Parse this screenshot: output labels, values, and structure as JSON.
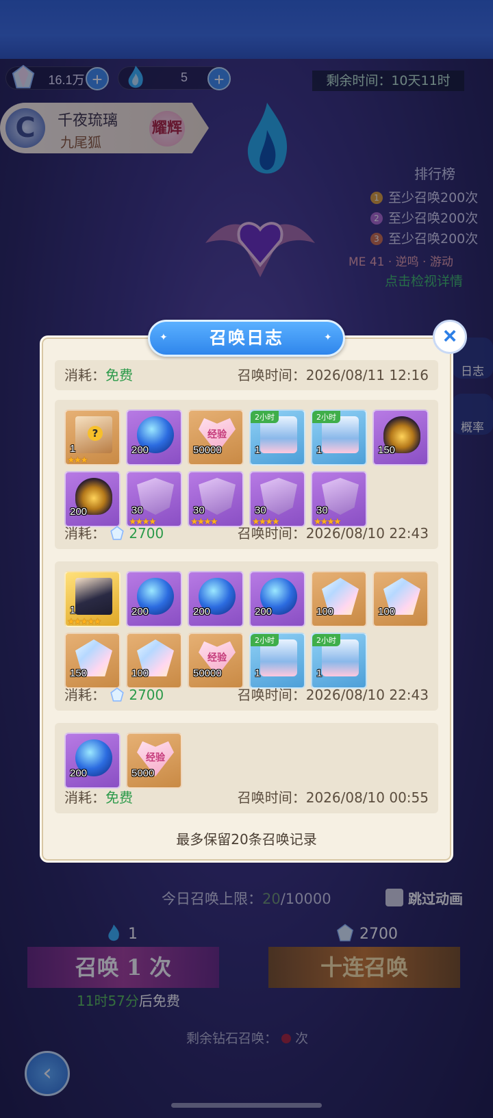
{
  "topbar": {
    "resource1": {
      "value": "16.1万",
      "icon": "crystal-gem-icon"
    },
    "resource2": {
      "value": "5",
      "icon": "blue-flame-icon"
    },
    "remaining_time": "剩余时间：10天11时"
  },
  "hero": {
    "name": "千夜琉璃",
    "subtitle": "九尾狐",
    "badge": "耀辉"
  },
  "ranking": {
    "title": "排行榜",
    "rows": [
      {
        "num": "1",
        "text": "至少召唤200次",
        "color": "#e0a23a"
      },
      {
        "num": "2",
        "text": "至少召唤200次",
        "color": "#b06ad0"
      },
      {
        "num": "3",
        "text": "至少召唤200次",
        "color": "#d0704a"
      }
    ],
    "me": "ME 41 · 逆鸣 · 游动",
    "detail_link": "点击检视详情"
  },
  "side_buttons": [
    {
      "label": "日志"
    },
    {
      "label": "概率"
    }
  ],
  "modal": {
    "title": "召唤日志",
    "footer_note": "最多保留20条召唤记录",
    "records": [
      {
        "cost_label": "消耗：",
        "cost_value": "免费",
        "cost_type": "free",
        "time_label": "召唤时间：",
        "time": "2026/08/11 12:16",
        "items": []
      },
      {
        "cost_label": "消耗：",
        "cost_value": "2700",
        "cost_type": "gem",
        "time_label": "召唤时间：",
        "time": "2026/08/10 22:43",
        "items": [
          {
            "kind": "mystery-box",
            "bg": "orange",
            "qty": "1",
            "stars": "★★★",
            "tag": ""
          },
          {
            "kind": "star-orb",
            "bg": "purple",
            "qty": "200",
            "stars": "",
            "tag": ""
          },
          {
            "kind": "exp-heart",
            "bg": "orange",
            "qty": "50000",
            "stars": "",
            "tag": "",
            "text": "经验"
          },
          {
            "kind": "treasure-chest",
            "bg": "blue",
            "qty": "1",
            "stars": "",
            "tag": "2小时"
          },
          {
            "kind": "treasure-chest",
            "bg": "blue",
            "qty": "1",
            "stars": "",
            "tag": "2小时"
          },
          {
            "kind": "golden-egg",
            "bg": "purple",
            "qty": "150",
            "stars": "",
            "tag": ""
          },
          {
            "kind": "golden-egg",
            "bg": "purple",
            "qty": "200",
            "stars": "",
            "tag": ""
          },
          {
            "kind": "soul-shard",
            "bg": "purple",
            "qty": "30",
            "stars": "★★★★",
            "tag": ""
          },
          {
            "kind": "soul-shard",
            "bg": "purple",
            "qty": "30",
            "stars": "★★★★",
            "tag": ""
          },
          {
            "kind": "soul-shard",
            "bg": "purple",
            "qty": "30",
            "stars": "★★★★",
            "tag": ""
          },
          {
            "kind": "soul-shard",
            "bg": "purple",
            "qty": "30",
            "stars": "★★★★",
            "tag": ""
          }
        ]
      },
      {
        "cost_label": "消耗：",
        "cost_value": "2700",
        "cost_type": "gem",
        "time_label": "召唤时间：",
        "time": "2026/08/10 22:43",
        "items": [
          {
            "kind": "hero-portrait",
            "bg": "gold",
            "qty": "1",
            "stars": "★★★★★",
            "tag": ""
          },
          {
            "kind": "star-orb",
            "bg": "purple",
            "qty": "200",
            "stars": "",
            "tag": ""
          },
          {
            "kind": "star-orb",
            "bg": "purple",
            "qty": "200",
            "stars": "",
            "tag": ""
          },
          {
            "kind": "star-orb",
            "bg": "purple",
            "qty": "200",
            "stars": "",
            "tag": ""
          },
          {
            "kind": "crystal-gem",
            "bg": "orange",
            "qty": "100",
            "stars": "",
            "tag": ""
          },
          {
            "kind": "crystal-gem",
            "bg": "orange",
            "qty": "100",
            "stars": "",
            "tag": ""
          },
          {
            "kind": "crystal-gem",
            "bg": "orange",
            "qty": "150",
            "stars": "",
            "tag": ""
          },
          {
            "kind": "crystal-gem",
            "bg": "orange",
            "qty": "100",
            "stars": "",
            "tag": ""
          },
          {
            "kind": "exp-heart",
            "bg": "orange",
            "qty": "50000",
            "stars": "",
            "tag": "",
            "text": "经验"
          },
          {
            "kind": "treasure-chest",
            "bg": "blue",
            "qty": "1",
            "stars": "",
            "tag": "2小时"
          },
          {
            "kind": "treasure-chest",
            "bg": "blue",
            "qty": "1",
            "stars": "",
            "tag": "2小时"
          }
        ]
      },
      {
        "cost_label": "消耗：",
        "cost_value": "免费",
        "cost_type": "free",
        "time_label": "召唤时间：",
        "time": "2026/08/10 00:55",
        "items": [
          {
            "kind": "star-orb",
            "bg": "purple",
            "qty": "200",
            "stars": "",
            "tag": ""
          },
          {
            "kind": "exp-heart",
            "bg": "orange",
            "qty": "5000",
            "stars": "",
            "tag": "",
            "text": "经验"
          }
        ]
      }
    ]
  },
  "bottom": {
    "daily_limit_label": "今日召唤上限：",
    "daily_limit_current": "20",
    "daily_limit_max": "/10000",
    "skip_label": "跳过动画",
    "cost_one": "1",
    "cost_ten": "2700",
    "btn_one": "召唤 1 次",
    "btn_ten": "十连召唤",
    "free_after_time": "11时57分",
    "free_after_suffix": "后免费",
    "remain_diamond_prefix": "剩余钻石召唤：",
    "remain_diamond_suffix": "次"
  }
}
